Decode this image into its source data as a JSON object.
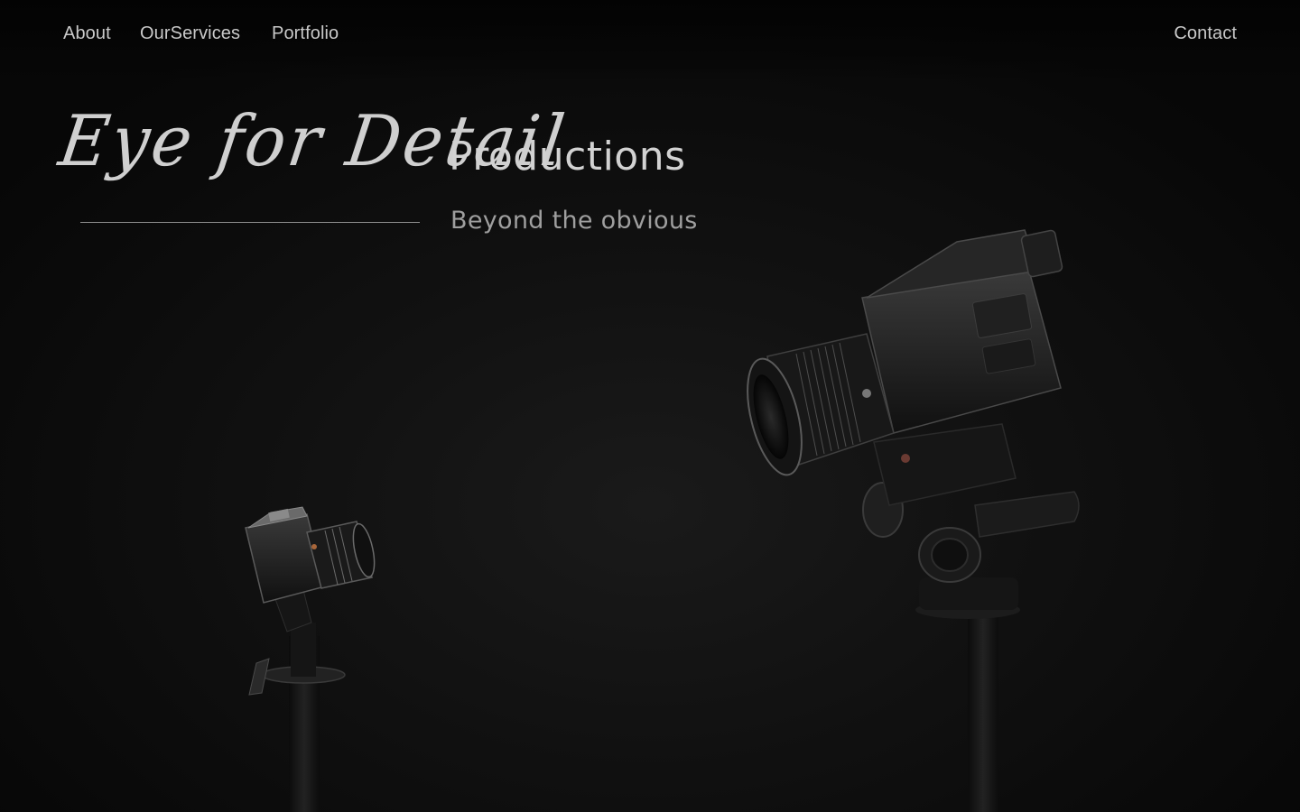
{
  "nav": {
    "about": "About",
    "services": "OurServices",
    "portfolio": "Portfolio",
    "contact": "Contact"
  },
  "hero": {
    "script_title": "Eye for Detail",
    "title_word": "Productions",
    "tagline": "Beyond the obvious"
  },
  "colors": {
    "background": "#0b0b0b",
    "text": "#c9c9c9",
    "tagline": "#9f9f9f"
  }
}
